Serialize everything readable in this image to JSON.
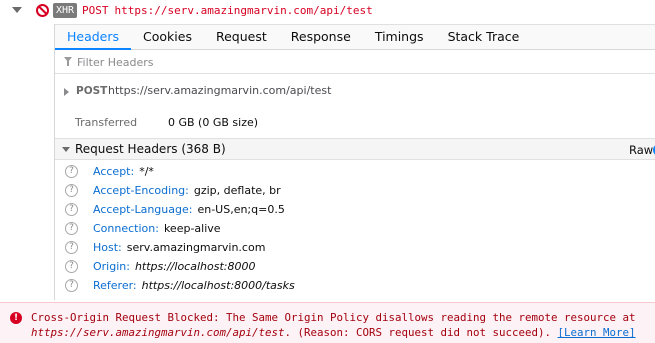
{
  "request": {
    "badge": "XHR",
    "method": "POST",
    "url": "https://serv.amazingmarvin.com/api/test"
  },
  "tabs": [
    {
      "label": "Headers",
      "selected": true
    },
    {
      "label": "Cookies",
      "selected": false
    },
    {
      "label": "Request",
      "selected": false
    },
    {
      "label": "Response",
      "selected": false
    },
    {
      "label": "Timings",
      "selected": false
    },
    {
      "label": "Stack Trace",
      "selected": false
    }
  ],
  "filter": {
    "placeholder": "Filter Headers",
    "value": ""
  },
  "summary": {
    "method": "POST",
    "url": "https://serv.amazingmarvin.com/api/test"
  },
  "transferred": {
    "label": "Transferred",
    "value": "0 GB (0 GB size)"
  },
  "request_headers": {
    "title": "Request Headers (368 B)",
    "raw_label": "Raw",
    "items": [
      {
        "name": "Accept:",
        "value": "*/*",
        "italic": false
      },
      {
        "name": "Accept-Encoding:",
        "value": "gzip, deflate, br",
        "italic": false
      },
      {
        "name": "Accept-Language:",
        "value": "en-US,en;q=0.5",
        "italic": false
      },
      {
        "name": "Connection:",
        "value": "keep-alive",
        "italic": false
      },
      {
        "name": "Host:",
        "value": "serv.amazingmarvin.com",
        "italic": false
      },
      {
        "name": "Origin:",
        "value": "https://localhost:8000",
        "italic": true
      },
      {
        "name": "Referer:",
        "value": "https://localhost:8000/tasks",
        "italic": true
      }
    ]
  },
  "console_error": {
    "line1": "Cross-Origin Request Blocked: The Same Origin Policy disallows reading the remote resource at",
    "url": "https://serv.amazingmarvin.com/api/test",
    "line2_rest": ". (Reason: CORS request did not succeed).",
    "learn_more": "[Learn More]"
  },
  "colors": {
    "error_red": "#d70022",
    "accent_blue": "#0a84ff",
    "header_name_blue": "#0a6dd1",
    "console_bg": "#fdf2f5"
  },
  "icons": {
    "expand": "twisty-down-icon",
    "blocked": "blocked-icon",
    "filter": "filter-icon",
    "help": "help-icon",
    "error": "error-icon"
  }
}
